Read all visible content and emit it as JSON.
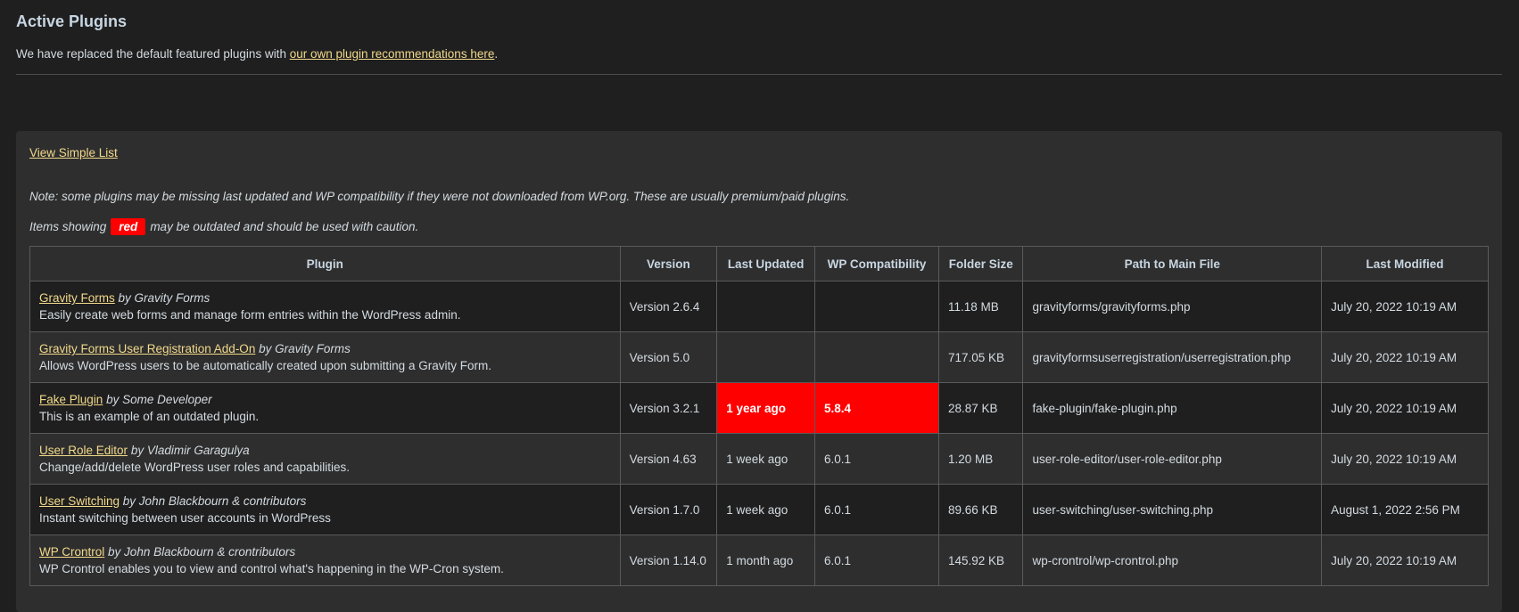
{
  "page": {
    "title": "Active Plugins",
    "intro_prefix": "We have replaced the default featured plugins with ",
    "intro_link": "our own plugin recommendations here",
    "intro_suffix": "."
  },
  "panel": {
    "simple_list_link": "View Simple List",
    "note": "Note: some plugins may be missing last updated and WP compatibility if they were not downloaded from WP.org. These are usually premium/paid plugins.",
    "outdated_prefix": "Items showing",
    "outdated_badge": "red",
    "outdated_suffix": "may be outdated and should be used with caution.",
    "badge_color": "#ff0000"
  },
  "table": {
    "headers": [
      "Plugin",
      "Version",
      "Last Updated",
      "WP Compatibility",
      "Folder Size",
      "Path to Main File",
      "Last Modified"
    ],
    "rows": [
      {
        "name": "Gravity Forms",
        "author": "by Gravity Forms",
        "description": "Easily create web forms and manage form entries within the WordPress admin.",
        "version": "Version 2.6.4",
        "last_updated": "",
        "wp_compat": "",
        "folder_size": "11.18 MB",
        "path": "gravityforms/gravityforms.php",
        "last_modified": "July 20, 2022 10:19 AM"
      },
      {
        "name": "Gravity Forms User Registration Add-On",
        "author": "by Gravity Forms",
        "description": "Allows WordPress users to be automatically created upon submitting a Gravity Form.",
        "version": "Version 5.0",
        "last_updated": "",
        "wp_compat": "",
        "folder_size": "717.05 KB",
        "path": "gravityformsuserregistration/userregistration.php",
        "last_modified": "July 20, 2022 10:19 AM"
      },
      {
        "name": "Fake Plugin",
        "author": "by Some Developer",
        "description": "This is an example of an outdated plugin.",
        "version": "Version 3.2.1",
        "last_updated": "1 year ago",
        "wp_compat": "5.8.4",
        "folder_size": "28.87 KB",
        "path": "fake-plugin/fake-plugin.php",
        "last_modified": "July 20, 2022 10:19 AM"
      },
      {
        "name": "User Role Editor",
        "author": "by Vladimir Garagulya",
        "description": "Change/add/delete WordPress user roles and capabilities.",
        "version": "Version 4.63",
        "last_updated": "1 week ago",
        "wp_compat": "6.0.1",
        "folder_size": "1.20 MB",
        "path": "user-role-editor/user-role-editor.php",
        "last_modified": "July 20, 2022 10:19 AM"
      },
      {
        "name": "User Switching",
        "author": "by John Blackbourn & contributors",
        "description": "Instant switching between user accounts in WordPress",
        "version": "Version 1.7.0",
        "last_updated": "1 week ago",
        "wp_compat": "6.0.1",
        "folder_size": "89.66 KB",
        "path": "user-switching/user-switching.php",
        "last_modified": "August 1, 2022 2:56 PM"
      },
      {
        "name": "WP Crontrol",
        "author": "by John Blackbourn & crontributors",
        "description": "WP Crontrol enables you to view and control what's happening in the WP-Cron system.",
        "version": "Version 1.14.0",
        "last_updated": "1 month ago",
        "wp_compat": "6.0.1",
        "folder_size": "145.92 KB",
        "path": "wp-crontrol/wp-crontrol.php",
        "last_modified": "July 20, 2022 10:19 AM"
      }
    ]
  },
  "colors": {
    "background": "#1f1f1f",
    "panel": "#2e2e2e",
    "link": "#f2d98b",
    "outdated": "#ff0000"
  }
}
